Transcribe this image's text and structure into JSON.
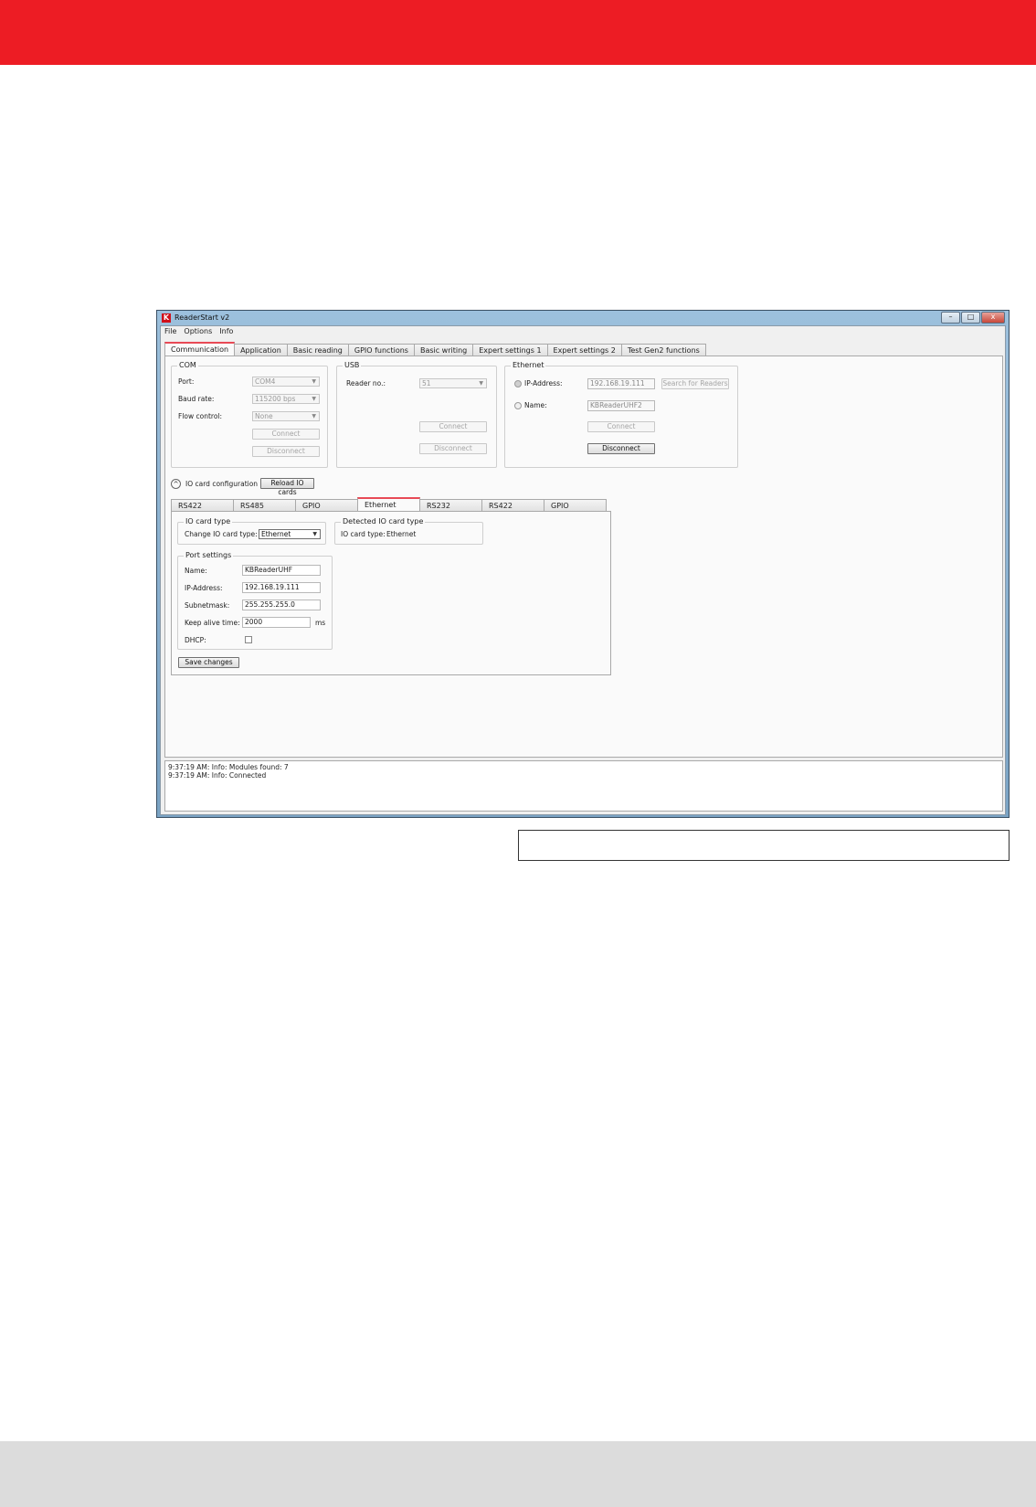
{
  "window": {
    "title": "ReaderStart v2",
    "app_icon_letter": "K",
    "minimize": "–",
    "maximize": "□",
    "close": "x"
  },
  "menu": [
    "File",
    "Options",
    "Info"
  ],
  "tabs": [
    "Communication",
    "Application",
    "Basic reading",
    "GPIO functions",
    "Basic writing",
    "Expert settings 1",
    "Expert settings 2",
    "Test Gen2 functions"
  ],
  "com": {
    "label": "COM",
    "port_label": "Port:",
    "port_value": "COM4",
    "baud_label": "Baud rate:",
    "baud_value": "115200 bps",
    "flow_label": "Flow control:",
    "flow_value": "None",
    "connect": "Connect",
    "disconnect": "Disconnect"
  },
  "usb": {
    "label": "USB",
    "reader_label": "Reader no.:",
    "reader_value": "51",
    "connect": "Connect",
    "disconnect": "Disconnect"
  },
  "ethernet": {
    "label": "Ethernet",
    "ip_label": "IP-Address:",
    "ip_value": "192.168.19.111",
    "search": "Search for Readers",
    "name_label": "Name:",
    "name_value": "KBReaderUHF2",
    "connect": "Connect",
    "disconnect": "Disconnect"
  },
  "io": {
    "expander_glyph": "^",
    "label": "IO card configuration",
    "reload": "Reload IO cards",
    "tabs": [
      "RS422",
      "RS485",
      "GPIO",
      "Ethernet",
      "RS232",
      "RS422",
      "GPIO"
    ],
    "card_type": {
      "label": "IO card type",
      "change_label": "Change IO card type:",
      "change_value": "Ethernet"
    },
    "detected": {
      "label": "Detected IO card type",
      "type_label": "IO card type:",
      "type_value": "Ethernet"
    },
    "port": {
      "label": "Port settings",
      "name_label": "Name:",
      "name_value": "KBReaderUHF",
      "ip_label": "IP-Address:",
      "ip_value": "192.168.19.111",
      "subnet_label": "Subnetmask:",
      "subnet_value": "255.255.255.0",
      "keepalive_label": "Keep alive time:",
      "keepalive_value": "2000",
      "keepalive_unit": "ms",
      "dhcp_label": "DHCP:"
    },
    "save": "Save changes"
  },
  "log": [
    "9:37:19 AM: Info: Modules found: 7",
    "9:37:19 AM: Info: Connected"
  ]
}
